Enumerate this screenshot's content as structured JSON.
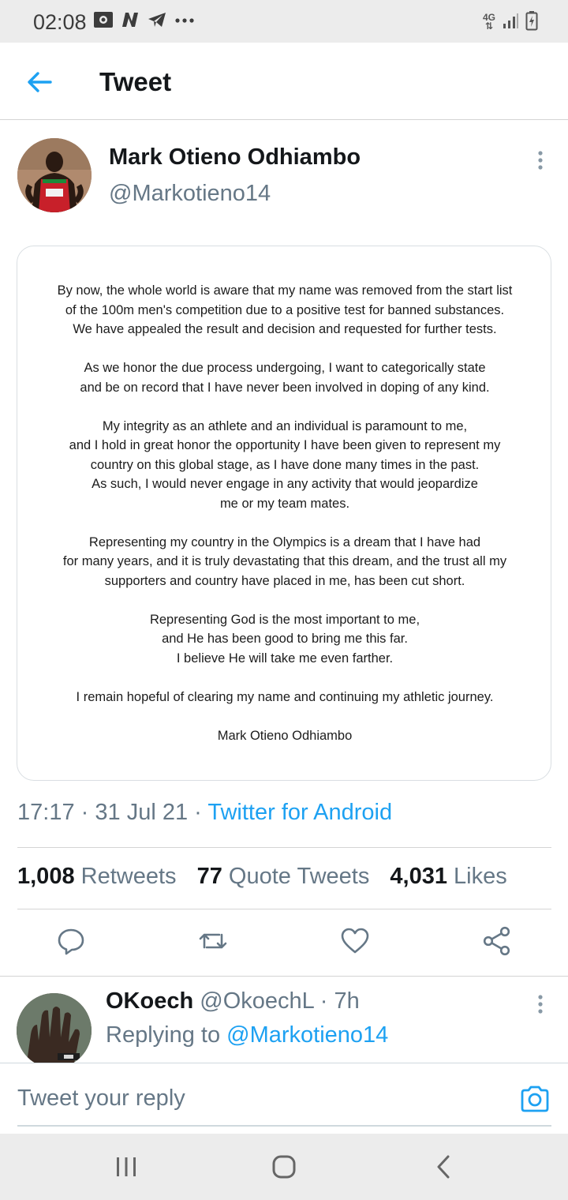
{
  "status_bar": {
    "time": "02:08",
    "network": "4G"
  },
  "header": {
    "title": "Tweet"
  },
  "tweet": {
    "author_name": "Mark Otieno Odhiambo",
    "author_handle": "@Markotieno14",
    "statement": {
      "paragraphs": [
        [
          "By now, the whole world is aware that my name was removed from the start list",
          "of the 100m men's competition due to a positive test for banned substances.",
          "We have appealed the result and decision and requested for further tests."
        ],
        [
          "As we honor the due process undergoing, I want to categorically state",
          "and be on record that I have never been involved in doping of any kind."
        ],
        [
          "My integrity as an athlete and an individual is paramount to me,",
          "and I hold in great honor the opportunity I have been given to represent my",
          "country on this global stage, as I have done many times in the past.",
          "As such, I would never engage in any activity that would jeopardize",
          "me or my team mates."
        ],
        [
          "Representing my country in the Olympics is a dream that I have had",
          "for many years, and it is truly devastating that this dream, and the trust all my",
          "supporters and country have placed in me, has been cut short."
        ],
        [
          "Representing God is the most important to me,",
          "and He has been good to bring me this far.",
          "I believe He will take me even farther."
        ],
        [
          "I remain hopeful of clearing my name and continuing my athletic journey."
        ]
      ],
      "signature": "Mark Otieno Odhiambo"
    },
    "time": "17:17",
    "date": "31 Jul 21",
    "separator": "·",
    "source": "Twitter for Android",
    "retweets_count": "1,008",
    "retweets_label": "Retweets",
    "quotes_count": "77",
    "quotes_label": "Quote Tweets",
    "likes_count": "4,031",
    "likes_label": "Likes"
  },
  "actions": [
    "reply-icon",
    "retweet-icon",
    "like-icon",
    "share-icon"
  ],
  "reply": {
    "name": "OKoech",
    "handle": "@OkoechL",
    "separator": "·",
    "time": "7h",
    "replying_to_label": "Replying to",
    "replying_to_handle": "@Markotieno14"
  },
  "compose": {
    "placeholder": "Tweet your reply"
  },
  "colors": {
    "accent": "#1da1f2",
    "text_primary": "#14171a",
    "text_secondary": "#657786",
    "divider": "#d4d4d4",
    "system_bar": "#ececec"
  }
}
